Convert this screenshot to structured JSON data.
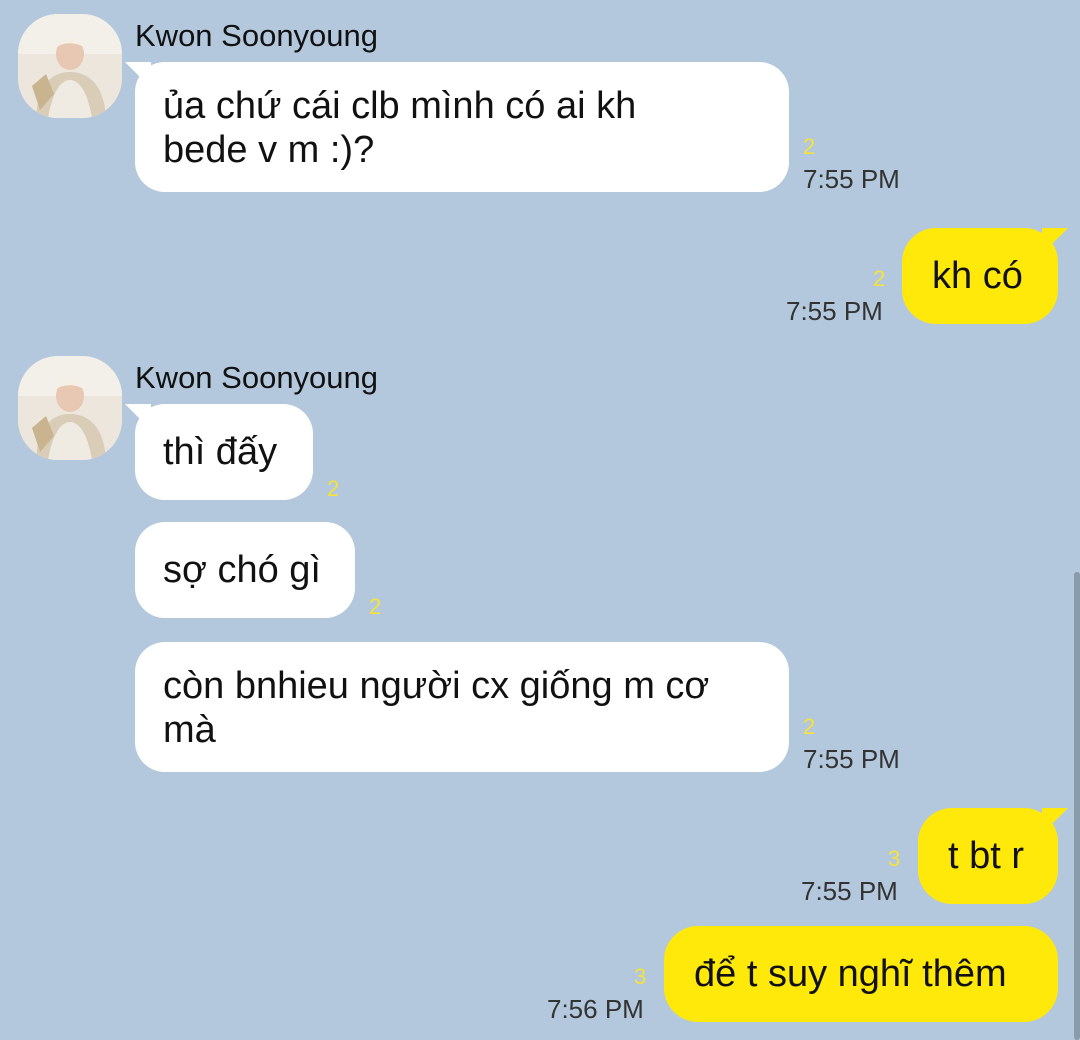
{
  "contact": {
    "name": "Kwon Soonyoung"
  },
  "messages": [
    {
      "dir": "in",
      "text": "ủa chứ cái clb mình có ai kh\nbede v m :)?",
      "unread": "2",
      "time": "7:55 PM"
    },
    {
      "dir": "out",
      "text": "kh có",
      "unread": "2",
      "time": "7:55 PM"
    },
    {
      "dir": "in",
      "text": "thì đấy",
      "unread": "2",
      "time": ""
    },
    {
      "dir": "in",
      "text": "sợ chó gì",
      "unread": "2",
      "time": ""
    },
    {
      "dir": "in",
      "text": "còn bnhieu người cx giống m cơ\nmà",
      "unread": "2",
      "time": "7:55 PM"
    },
    {
      "dir": "out",
      "text": "t bt r",
      "unread": "3",
      "time": "7:55 PM"
    },
    {
      "dir": "out",
      "text": "để t suy nghĩ thêm",
      "unread": "3",
      "time": "7:56 PM"
    }
  ]
}
